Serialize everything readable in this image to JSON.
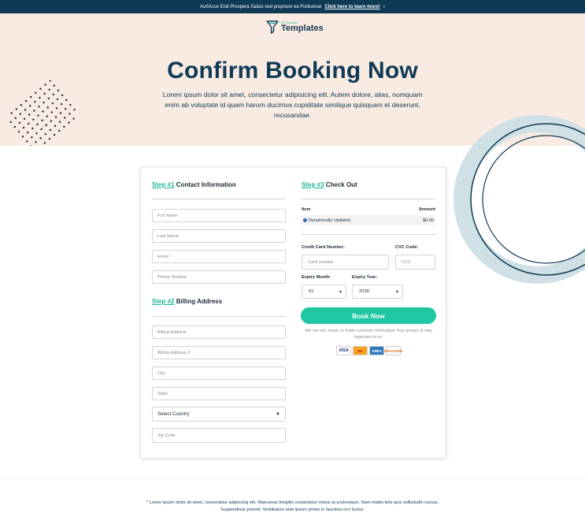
{
  "topbar": {
    "text": "AurlAcus Erat Prospera Saluis sed proprium ea Fortiumue",
    "cta": "Click here to learn more!",
    "chevron": "›"
  },
  "logo": {
    "small": "GF Funnels",
    "big": "Templates",
    "icon": "funnel-icon"
  },
  "hero": {
    "title": "Confirm Booking Now",
    "text": "Lorem ipsum dolor sit amet, consectetur adipisicing elit. Autem dolore, alias, numquam enim ab voluptate id quam harum ducimus cupiditate similique quisquam et deserunt, recusandae."
  },
  "step1": {
    "num": "Step #1",
    "label": "Contact Information",
    "fields": [
      "Full Name",
      "Last Name",
      "Email",
      "Phone Number"
    ]
  },
  "step2": {
    "num": "Step #2",
    "label": "Billing Address",
    "fields": [
      "Billing Address",
      "Billing Address 2",
      "City",
      "State"
    ],
    "country": "Select Country",
    "zip": "Zip Code"
  },
  "step3": {
    "num": "Step #3",
    "label": "Check Out",
    "table": {
      "item_header": "Item",
      "amount_header": "Amount",
      "row_item": "Dynamically Updated",
      "row_amount": "$0.00"
    },
    "cc_label": "Credit Card Number:",
    "cc_placeholder": "Card number",
    "cvc_label": "CVC Code:",
    "cvc_placeholder": "CVC",
    "month_label": "Expiry Month:",
    "month_value": "01",
    "year_label": "Expiry Year:",
    "year_value": "2018",
    "button": "Book Now",
    "privacy": "We not sell, share, or trade customer information.Your privacy is very important to us.",
    "cards": [
      "VISA",
      "MC",
      "AMEX",
      "DISCOVER"
    ]
  },
  "footer": {
    "text": "* Lorem ipsum dolor sit amet, consectetur adipiscing elit. Maecenas fringilla consectetur metus at scelerisque. Nam mattis felis quis sollicitudin cursus. Suspendisse potenti. Vestibulum ante ipsum primis in faucibus orci luctus."
  },
  "colors": {
    "navy": "#0f3a55",
    "teal": "#1fc7a5",
    "hero_bg": "#f9ebe1",
    "ring": "#cfe1e6"
  }
}
